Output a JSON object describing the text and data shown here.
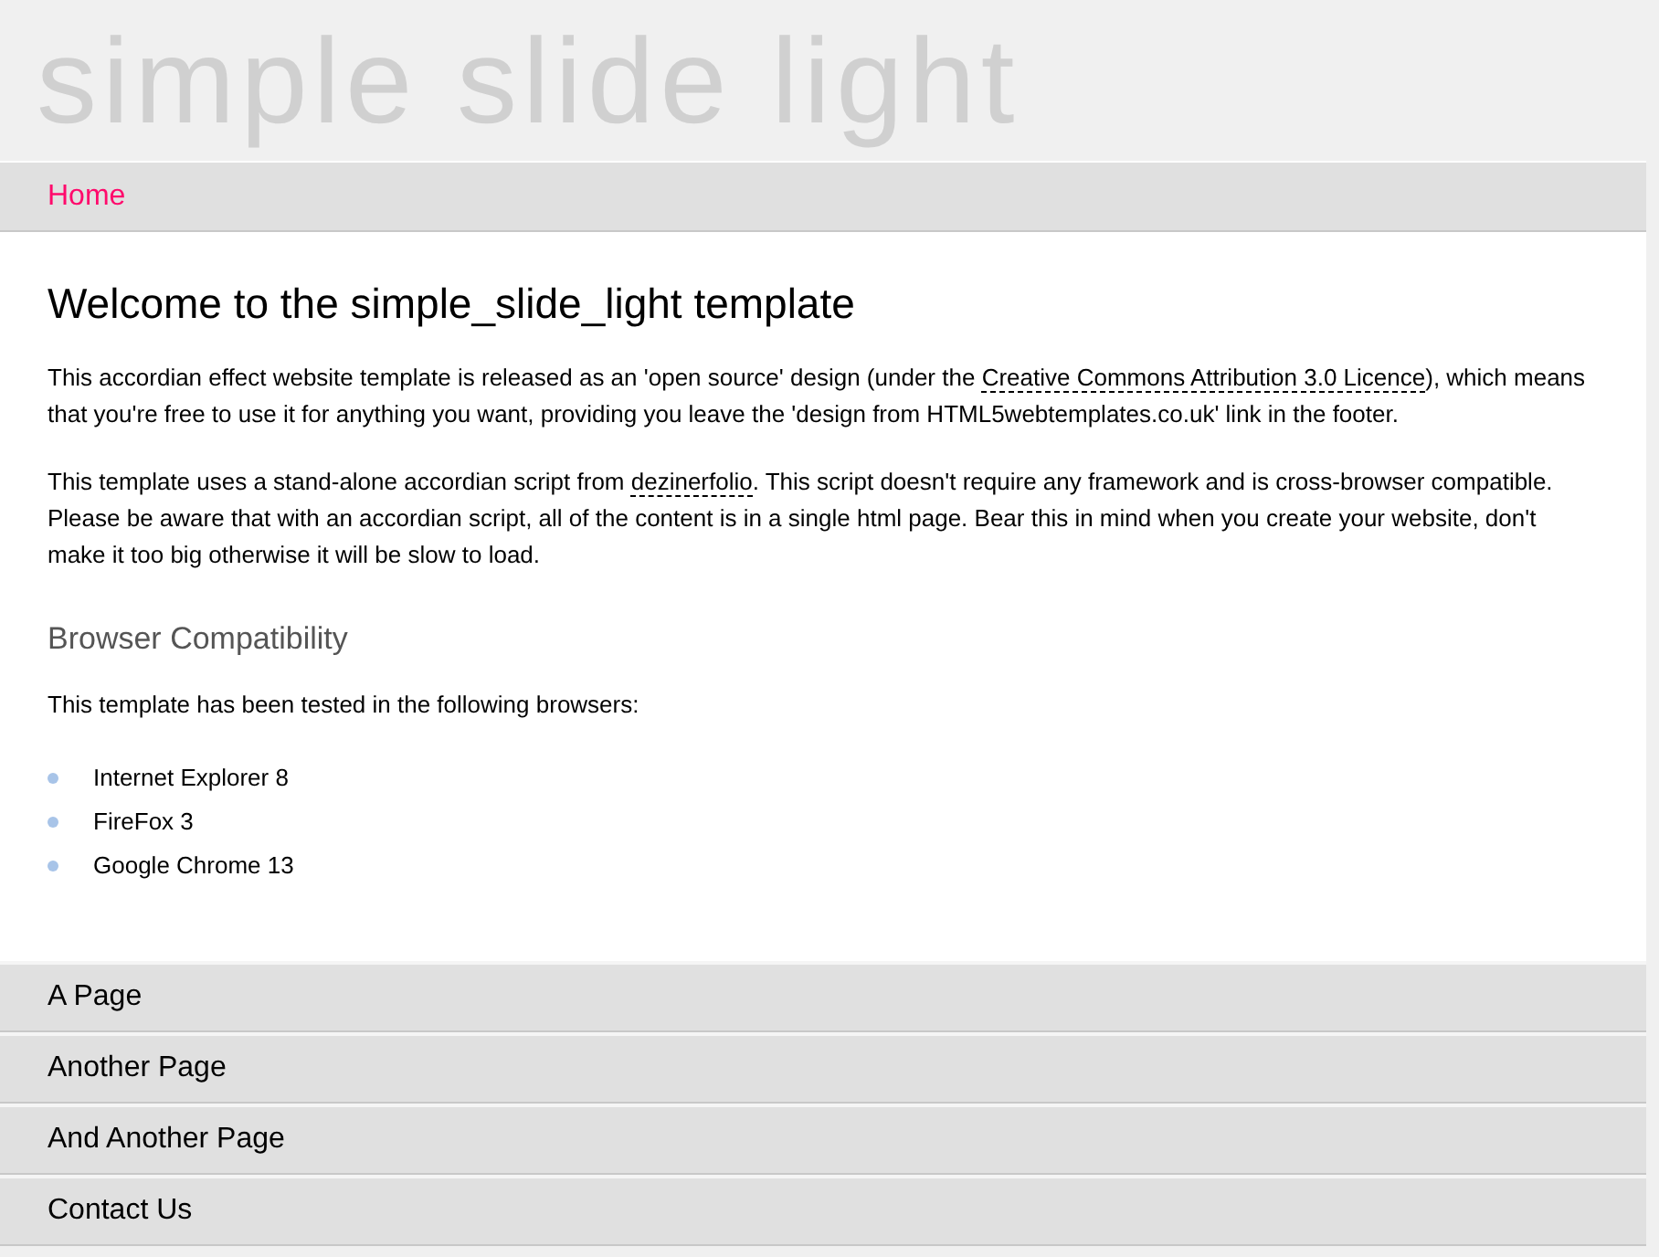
{
  "logo": "simple slide light",
  "sections": [
    {
      "title": "Home",
      "selected": true,
      "content": {
        "heading": "Welcome to the simple_slide_light template",
        "paragraphs": [
          [
            {
              "kind": "text",
              "text": "This accordian effect website template is released as an 'open source' design (under the "
            },
            {
              "kind": "link",
              "text": "Creative Commons Attribution 3.0 Licence"
            },
            {
              "kind": "text",
              "text": "), which means that you're free to use it for anything you want, providing you leave the 'design from HTML5webtemplates.co.uk' link in the footer."
            }
          ],
          [
            {
              "kind": "text",
              "text": "This template uses a stand-alone accordian script from "
            },
            {
              "kind": "link",
              "text": "dezinerfolio"
            },
            {
              "kind": "text",
              "text": ". This script doesn't require any framework and is cross-browser compatible. Please be aware that with an accordian script, all of the content is in a single html page. Bear this in mind when you create your website, don't make it too big otherwise it will be slow to load."
            }
          ]
        ],
        "subheading": "Browser Compatibility",
        "intro": "This template has been tested in the following browsers:",
        "list": [
          "Internet Explorer 8",
          "FireFox 3",
          "Google Chrome 13"
        ]
      }
    },
    {
      "title": "A Page",
      "selected": false
    },
    {
      "title": "Another Page",
      "selected": false
    },
    {
      "title": "And Another Page",
      "selected": false
    },
    {
      "title": "Contact Us",
      "selected": false
    }
  ]
}
